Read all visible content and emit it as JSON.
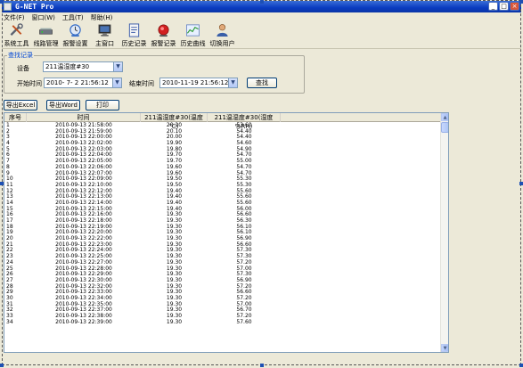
{
  "window": {
    "title": "G-NET Pro",
    "btn_min": "_",
    "btn_max": "□",
    "btn_close": "×"
  },
  "menu": [
    {
      "label": "文件(F)"
    },
    {
      "label": "窗口(W)"
    },
    {
      "label": "工具(T)"
    },
    {
      "label": "帮助(H)"
    }
  ],
  "toolbar": [
    {
      "label": "系统工具",
      "icon": "tools-icon"
    },
    {
      "label": "线路管理",
      "icon": "line-manage-icon"
    },
    {
      "label": "报警设置",
      "icon": "alarm-settings-icon"
    },
    {
      "label": "主窗口",
      "icon": "monitor-icon"
    },
    {
      "label": "历史记录",
      "icon": "history-records-icon"
    },
    {
      "label": "报警记录",
      "icon": "alarm-records-icon"
    },
    {
      "label": "历史曲线",
      "icon": "history-curve-icon"
    },
    {
      "label": "切换用户",
      "icon": "switch-user-icon"
    }
  ],
  "query": {
    "group_title": "查找记录",
    "device_label": "设备",
    "device_value": "211温湿度#30",
    "start_label": "开始时间",
    "start_value": "2010-  7-  2 21:56:12",
    "end_label": "结束时间",
    "end_value": "2010-11-19 21:56:12",
    "search_button": "查找"
  },
  "actions": {
    "export_excel": "导出Excel",
    "export_word": "导出Word",
    "print": "打印"
  },
  "table": {
    "columns": [
      "序号",
      "时间",
      "211温湿度#30(温度 ℃)",
      "211温湿度#30(湿度 %RH)"
    ],
    "rows": [
      [
        "1",
        "2010-09-13 21:58:00",
        "20.20",
        "53.60"
      ],
      [
        "2",
        "2010-09-13 21:59:00",
        "20.10",
        "54.40"
      ],
      [
        "3",
        "2010-09-13 22:00:00",
        "20.00",
        "54.40"
      ],
      [
        "4",
        "2010-09-13 22:02:00",
        "19.90",
        "54.60"
      ],
      [
        "5",
        "2010-09-13 22:03:00",
        "19.80",
        "54.90"
      ],
      [
        "6",
        "2010-09-13 22:04:00",
        "19.70",
        "54.70"
      ],
      [
        "7",
        "2010-09-13 22:05:00",
        "19.70",
        "55.00"
      ],
      [
        "8",
        "2010-09-13 22:06:00",
        "19.60",
        "54.70"
      ],
      [
        "9",
        "2010-09-13 22:07:00",
        "19.60",
        "54.70"
      ],
      [
        "10",
        "2010-09-13 22:09:00",
        "19.50",
        "55.30"
      ],
      [
        "11",
        "2010-09-13 22:10:00",
        "19.50",
        "55.30"
      ],
      [
        "12",
        "2010-09-13 22:12:00",
        "19.40",
        "55.60"
      ],
      [
        "13",
        "2010-09-13 22:13:00",
        "19.40",
        "55.60"
      ],
      [
        "14",
        "2010-09-13 22:14:00",
        "19.40",
        "55.60"
      ],
      [
        "15",
        "2010-09-13 22:15:00",
        "19.40",
        "56.00"
      ],
      [
        "16",
        "2010-09-13 22:16:00",
        "19.30",
        "56.60"
      ],
      [
        "17",
        "2010-09-13 22:18:00",
        "19.30",
        "56.30"
      ],
      [
        "18",
        "2010-09-13 22:19:00",
        "19.30",
        "56.10"
      ],
      [
        "19",
        "2010-09-13 22:20:00",
        "19.30",
        "56.10"
      ],
      [
        "20",
        "2010-09-13 22:22:00",
        "19.30",
        "56.90"
      ],
      [
        "21",
        "2010-09-13 22:23:00",
        "19.30",
        "56.60"
      ],
      [
        "22",
        "2010-09-13 22:24:00",
        "19.30",
        "57.30"
      ],
      [
        "23",
        "2010-09-13 22:25:00",
        "19.30",
        "57.30"
      ],
      [
        "24",
        "2010-09-13 22:27:00",
        "19.30",
        "57.20"
      ],
      [
        "25",
        "2010-09-13 22:28:00",
        "19.30",
        "57.00"
      ],
      [
        "26",
        "2010-09-13 22:29:00",
        "19.30",
        "57.30"
      ],
      [
        "27",
        "2010-09-13 22:30:00",
        "19.30",
        "56.90"
      ],
      [
        "28",
        "2010-09-13 22:32:00",
        "19.30",
        "57.20"
      ],
      [
        "29",
        "2010-09-13 22:33:00",
        "19.30",
        "56.60"
      ],
      [
        "30",
        "2010-09-13 22:34:00",
        "19.30",
        "57.20"
      ],
      [
        "31",
        "2010-09-13 22:35:00",
        "19.30",
        "57.00"
      ],
      [
        "32",
        "2010-09-13 22:37:00",
        "19.30",
        "56.70"
      ],
      [
        "33",
        "2010-09-13 22:38:00",
        "19.30",
        "57.20"
      ],
      [
        "34",
        "2010-09-13 22:39:00",
        "19.30",
        "57.60"
      ]
    ]
  },
  "colors": {
    "title_bar": "#0a3bbf",
    "group_title": "#0046d5",
    "background": "#ece9d8"
  }
}
